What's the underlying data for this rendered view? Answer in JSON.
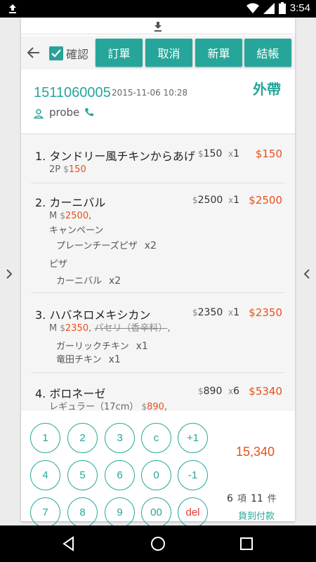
{
  "status": {
    "time": "3:54"
  },
  "toolbar": {
    "confirm_label": "確認",
    "buttons": [
      "訂單",
      "取消",
      "新單",
      "結帳"
    ]
  },
  "order": {
    "number": "1511060005",
    "datetime": "2015-11-06 10:28",
    "type": "外帶",
    "customer": "probe"
  },
  "items": [
    {
      "index": "1.",
      "name": "タンドリー風チキンからあげ",
      "price": "150",
      "qty": "1",
      "total": "$150",
      "sub": {
        "size": "2P",
        "size_price": "150"
      }
    },
    {
      "index": "2.",
      "name": "カーニバル",
      "price": "2500",
      "qty": "1",
      "total": "$2500",
      "sub": {
        "size": "M",
        "size_price": "2500"
      },
      "groups": [
        {
          "label": "キャンペーン",
          "options": [
            {
              "name": "プレーンチーズピザ",
              "qty": "x2"
            }
          ]
        },
        {
          "label": "ピザ",
          "options": [
            {
              "name": "カーニバル",
              "qty": "x2"
            }
          ]
        }
      ]
    },
    {
      "index": "3.",
      "name": "ハバネロメキシカン",
      "price": "2350",
      "qty": "1",
      "total": "$2350",
      "sub": {
        "size": "M",
        "size_price": "2350",
        "removed": "パセリ（香辛料）"
      },
      "options": [
        {
          "name": "ガーリックチキン",
          "qty": "x1"
        },
        {
          "name": "竜田チキン",
          "qty": "x1"
        }
      ]
    },
    {
      "index": "4.",
      "name": "ボロネーゼ",
      "price": "890",
      "qty": "6",
      "total": "$5340",
      "sub": {
        "size": "レギュラー（17cm）",
        "size_price": "890"
      }
    }
  ],
  "keypad": {
    "keys": [
      "1",
      "2",
      "3",
      "c",
      "+1",
      "4",
      "5",
      "6",
      "0",
      "-1",
      "7",
      "8",
      "9",
      "00",
      "del"
    ]
  },
  "summary": {
    "grand_total": "15,340",
    "item_count": "6",
    "item_unit": "項",
    "piece_count": "11",
    "piece_unit": "件",
    "payment": "貨到付款"
  },
  "colors": {
    "accent": "#26a69a",
    "price_red": "#e8501a",
    "del_red": "#e53935"
  }
}
